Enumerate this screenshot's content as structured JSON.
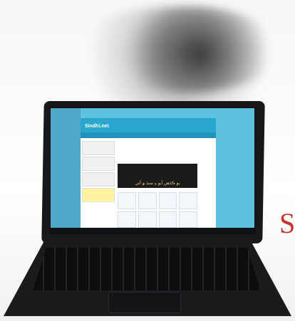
{
  "image": {
    "subject": "Laptop showing a website on its screen",
    "screen_site": {
      "logo_text": "Sindhi.net",
      "banner_text": "يو ڪڏهن آيو ۽ سنڌ ۾ آئي"
    },
    "partial_letter": "S"
  }
}
